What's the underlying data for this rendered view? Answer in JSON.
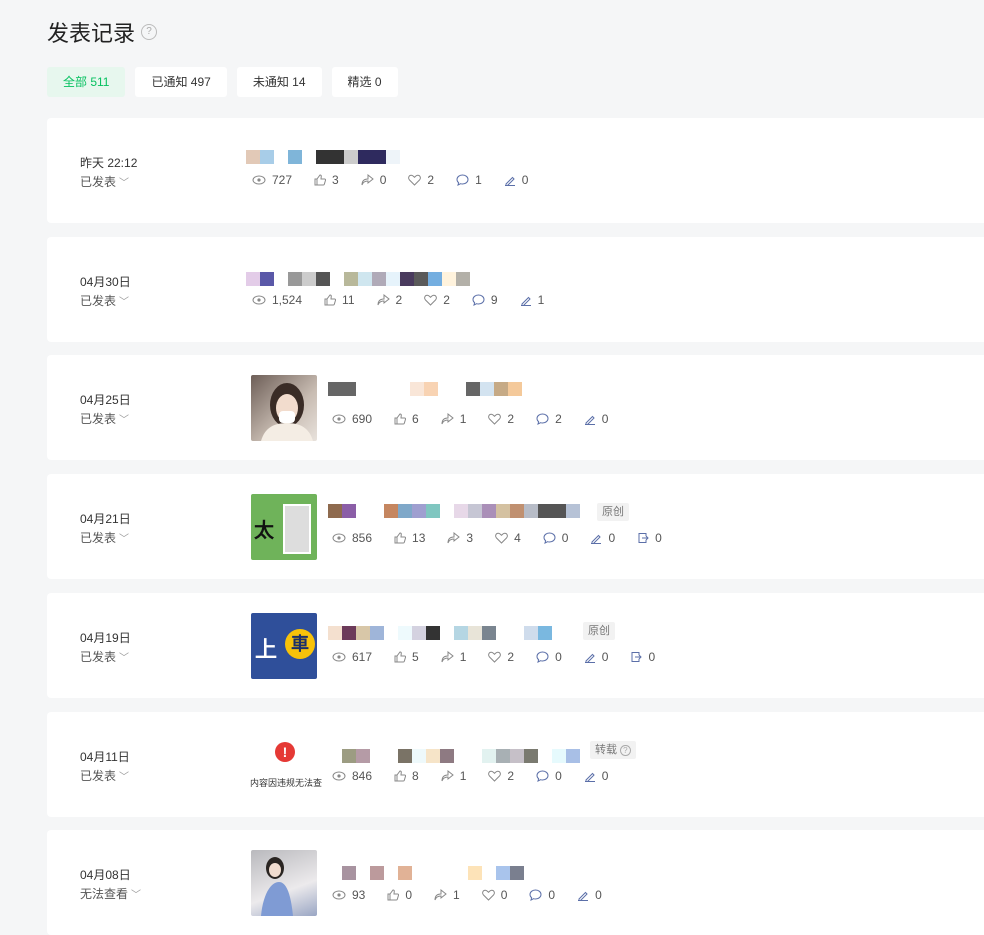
{
  "header": {
    "title": "发表记录",
    "help_icon": "help-circle-icon"
  },
  "filters": [
    {
      "label": "全部 511",
      "active": true
    },
    {
      "label": "已通知 497"
    },
    {
      "label": "未通知 14"
    },
    {
      "label": "精选 0"
    }
  ],
  "posts": [
    {
      "date": "昨天 22:12",
      "status": "已发表",
      "views": "727",
      "likes": "3",
      "shares": "0",
      "favs": "2",
      "comments": "1",
      "edits": "0"
    },
    {
      "date": "04月30日",
      "status": "已发表",
      "views": "1,524",
      "likes": "11",
      "shares": "2",
      "favs": "2",
      "comments": "9",
      "edits": "1"
    },
    {
      "date": "04月25日",
      "status": "已发表",
      "views": "690",
      "likes": "6",
      "shares": "1",
      "favs": "2",
      "comments": "2",
      "edits": "0"
    },
    {
      "date": "04月21日",
      "status": "已发表",
      "tag": "原创",
      "views": "856",
      "likes": "13",
      "shares": "3",
      "favs": "4",
      "comments": "0",
      "edits": "0",
      "reposts": "0",
      "thumb_text": "太"
    },
    {
      "date": "04月19日",
      "status": "已发表",
      "tag": "原创",
      "views": "617",
      "likes": "5",
      "shares": "1",
      "favs": "2",
      "comments": "0",
      "edits": "0",
      "reposts": "0",
      "thumb_text_1": "上",
      "thumb_text_2": "車"
    },
    {
      "date": "04月11日",
      "status": "已发表",
      "tag": "转载",
      "violation": "内容因违规无法查",
      "views": "846",
      "likes": "8",
      "shares": "1",
      "favs": "2",
      "comments": "0",
      "edits": "0"
    },
    {
      "date": "04月08日",
      "status": "无法查看",
      "views": "93",
      "likes": "0",
      "shares": "1",
      "favs": "0",
      "comments": "0",
      "edits": "0"
    }
  ],
  "colors": {
    "accent": "#07c160",
    "accent_bg": "#e7f7ee",
    "warn": "#e53935"
  }
}
